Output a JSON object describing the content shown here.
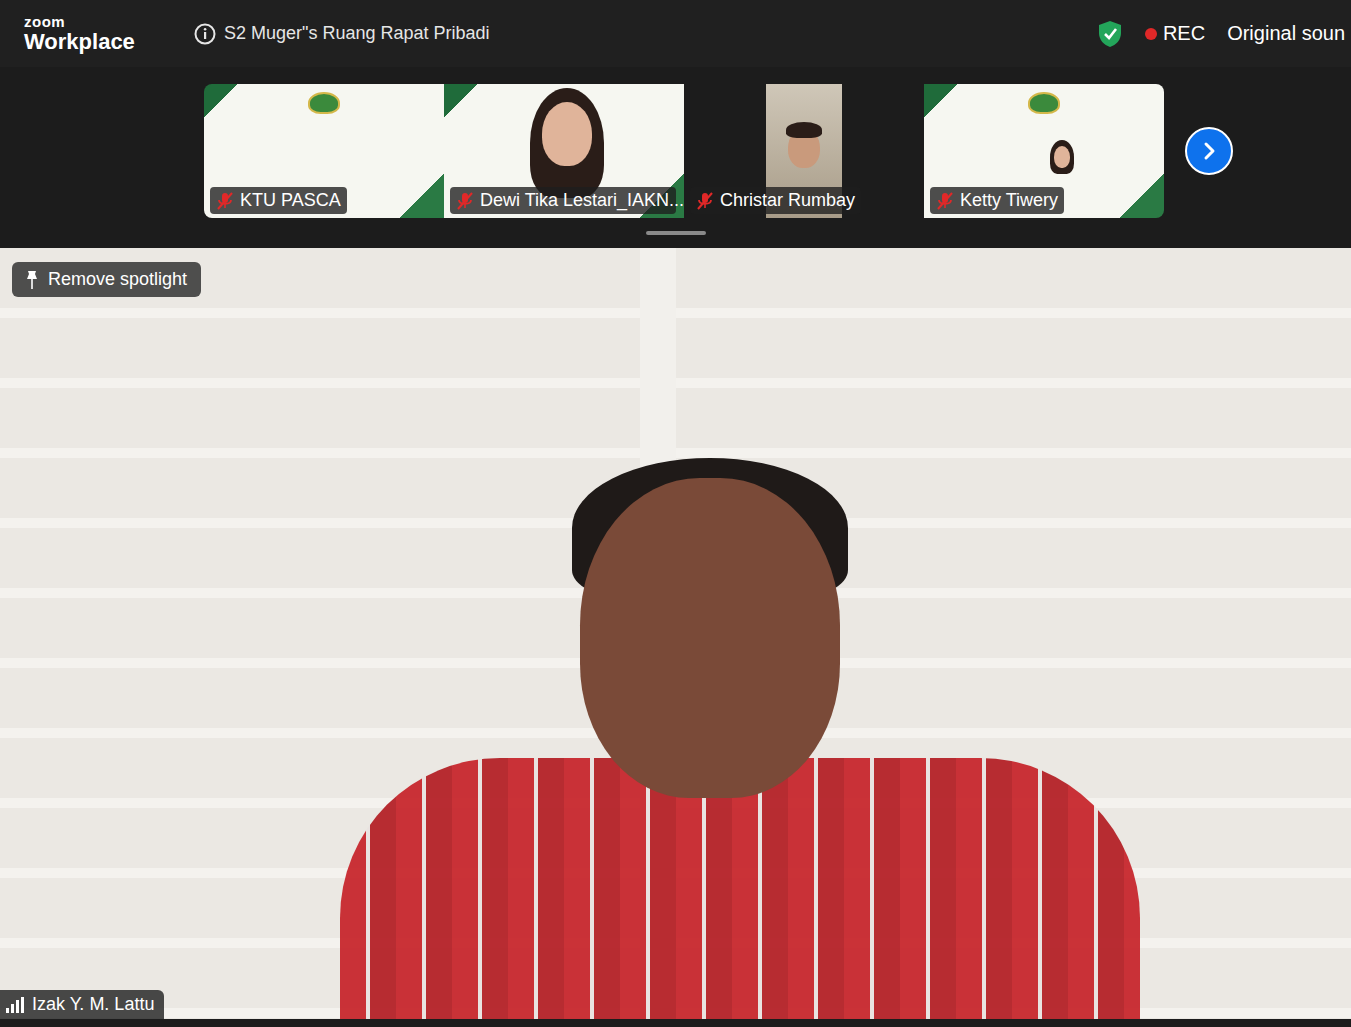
{
  "window": {
    "app": "zoom",
    "product": "Workplace",
    "title": "S2 Muger\"s Ruang Rapat Pribadi"
  },
  "recording": {
    "on": true,
    "label": "REC",
    "color": "#e02828"
  },
  "audio": {
    "label": "Original soun"
  },
  "participants": [
    {
      "name": "KTU PASCA",
      "muted": true,
      "kind": "branded"
    },
    {
      "name": "Dewi Tika Lestari_IAKN...",
      "muted": true,
      "kind": "branded-person"
    },
    {
      "name": "Christar Rumbay",
      "muted": true,
      "kind": "dark"
    },
    {
      "name": "Ketty Tiwery",
      "muted": true,
      "kind": "branded-small-person"
    }
  ],
  "spotlight": {
    "label": "Remove spotlight"
  },
  "speaker": {
    "name": "Izak Y. M. Lattu"
  }
}
